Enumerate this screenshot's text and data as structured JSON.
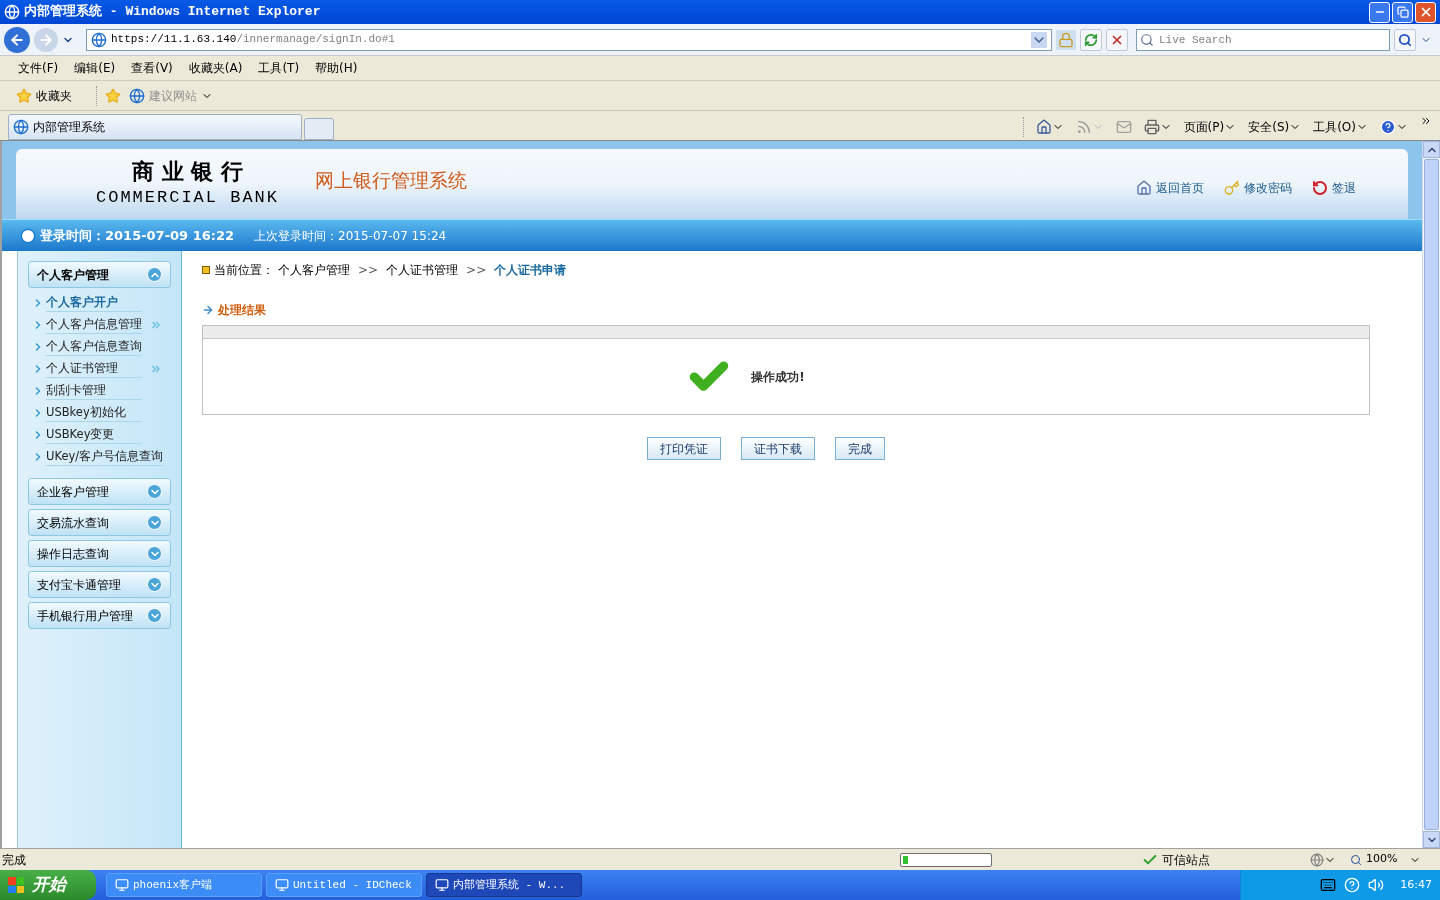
{
  "window": {
    "title": "内部管理系统 - Windows Internet Explorer"
  },
  "address_bar": {
    "host": "https://11.1.63.140",
    "path": "/innermanage/signIn.do#1"
  },
  "search": {
    "placeholder": "Live Search"
  },
  "menu": [
    "文件(F)",
    "编辑(E)",
    "查看(V)",
    "收藏夹(A)",
    "工具(T)",
    "帮助(H)"
  ],
  "favorites_bar": {
    "favorites": "收藏夹",
    "suggested": "建议网站"
  },
  "tabs": [
    {
      "title": "内部管理系统",
      "selected": true
    }
  ],
  "command_bar": [
    "页面(P)",
    "安全(S)",
    "工具(O)"
  ],
  "page": {
    "bank_name": "商 业 银 行",
    "bank_name_en": "COMMERCIAL BANK",
    "system_title": "网上银行管理系统",
    "header_links": [
      {
        "kind": "home",
        "text": "返回首页"
      },
      {
        "kind": "key",
        "text": "修改密码"
      },
      {
        "kind": "logout",
        "text": "签退"
      }
    ],
    "login_time": "登录时间：2015-07-09 16:22",
    "last_login": "上次登录时间：2015-07-07 15:24",
    "sidebar": [
      {
        "title": "个人客户管理",
        "expanded": true,
        "items": [
          {
            "text": "个人客户开户",
            "selected": true,
            "submenu": false
          },
          {
            "text": "个人客户信息管理",
            "selected": false,
            "submenu": true
          },
          {
            "text": "个人客户信息查询",
            "selected": false,
            "submenu": false
          },
          {
            "text": "个人证书管理",
            "selected": false,
            "submenu": true
          },
          {
            "text": "刮刮卡管理",
            "selected": false,
            "submenu": false
          },
          {
            "text": "USBkey初始化",
            "selected": false,
            "submenu": false
          },
          {
            "text": "USBKey变更",
            "selected": false,
            "submenu": false
          },
          {
            "text": "UKey/客户号信息查询",
            "selected": false,
            "submenu": false
          }
        ]
      },
      {
        "title": "企业客户管理",
        "expanded": false
      },
      {
        "title": "交易流水查询",
        "expanded": false
      },
      {
        "title": "操作日志查询",
        "expanded": false
      },
      {
        "title": "支付宝卡通管理",
        "expanded": false
      },
      {
        "title": "手机银行用户管理",
        "expanded": false
      }
    ],
    "breadcrumb_label": "当前位置：",
    "breadcrumb": [
      {
        "kind": "crumb",
        "text": "个人客户管理"
      },
      {
        "kind": "separator",
        "text": ">>"
      },
      {
        "kind": "crumb",
        "text": "个人证书管理"
      },
      {
        "kind": "separator",
        "text": ">>"
      },
      {
        "kind": "current",
        "text": "个人证书申请"
      }
    ],
    "section_title": "处理结果",
    "message": "操作成功!",
    "buttons": [
      "打印凭证",
      "证书下载",
      "完成"
    ]
  },
  "status_bar": {
    "text": "完成",
    "progress": {
      "level": 0.06
    },
    "zone": "可信站点",
    "zoom": "100%"
  },
  "taskbar": {
    "start": "开始",
    "tasks": [
      {
        "title": "phoenix客户端",
        "selected": false
      },
      {
        "title": "Untitled - IDCheck",
        "selected": false
      },
      {
        "title": "内部管理系统 - W...",
        "selected": true
      }
    ],
    "clock": "16:47"
  }
}
